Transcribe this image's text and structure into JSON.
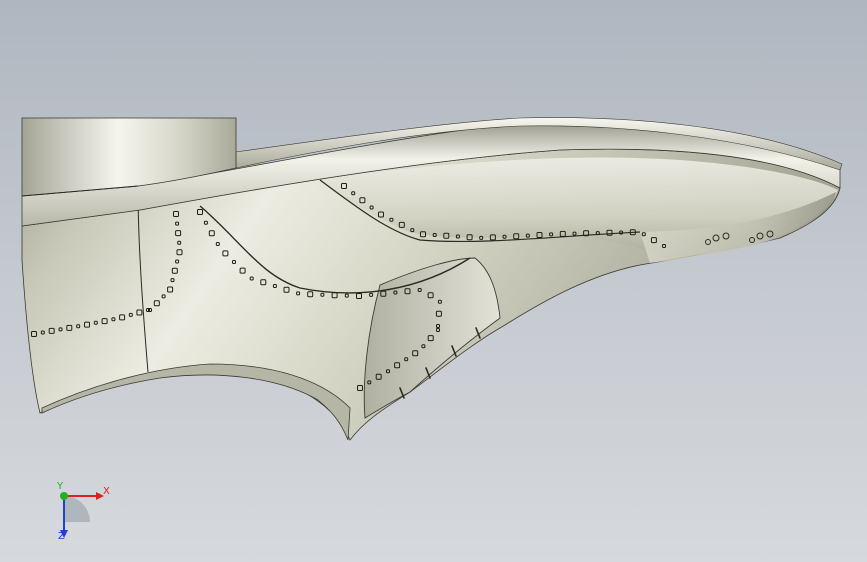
{
  "viewport": {
    "background_top": "#b0b6bf",
    "background_bottom": "#d6d9dd"
  },
  "model": {
    "type": "shoe-last-3d",
    "body_color": "#d0d0c1",
    "highlight_color": "#f4f4ec",
    "shadow_color": "#8e8e80",
    "edge_color": "#2a2a22"
  },
  "triad": {
    "x_label": "X",
    "y_label": "Y",
    "z_label": "Z",
    "x_color": "#e02020",
    "y_color": "#20b020",
    "z_color": "#2040d0"
  }
}
